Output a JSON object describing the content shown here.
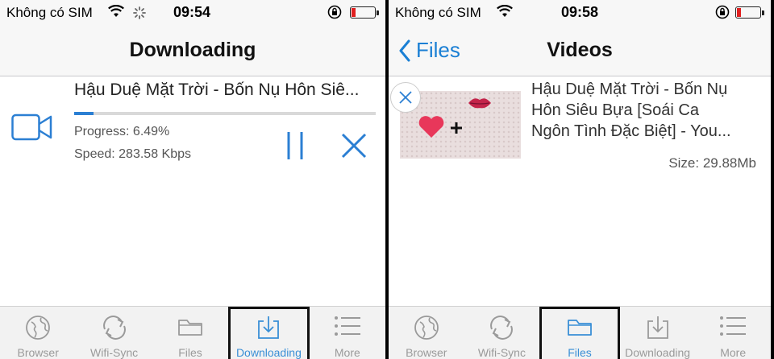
{
  "left": {
    "status": {
      "carrier": "Không có SIM",
      "time": "09:54"
    },
    "nav": {
      "title": "Downloading"
    },
    "download": {
      "title": "Hậu Duệ Mặt Trời - Bốn Nụ Hôn Siê...",
      "progress_text": "Progress: 6.49%",
      "speed_text": "Speed: 283.58 Kbps",
      "progress_value": 6.49
    },
    "tabs": [
      {
        "label": "Browser",
        "icon": "globe-icon"
      },
      {
        "label": "Wifi-Sync",
        "icon": "sync-icon"
      },
      {
        "label": "Files",
        "icon": "folder-icon"
      },
      {
        "label": "Downloading",
        "icon": "download-icon",
        "active": true
      },
      {
        "label": "More",
        "icon": "menu-icon"
      }
    ]
  },
  "right": {
    "status": {
      "carrier": "Không có SIM",
      "time": "09:58"
    },
    "nav": {
      "title": "Videos",
      "back": "Files"
    },
    "file": {
      "title_lines": [
        "Hậu Duệ Mặt Trời - Bốn Nụ",
        "Hôn Siêu Bựa [Soái Ca",
        "Ngôn Tình Đặc Biệt] - You..."
      ],
      "size": "Size: 29.88Mb"
    },
    "tabs": [
      {
        "label": "Browser",
        "icon": "globe-icon"
      },
      {
        "label": "Wifi-Sync",
        "icon": "sync-icon"
      },
      {
        "label": "Files",
        "icon": "folder-icon",
        "active": true
      },
      {
        "label": "Downloading",
        "icon": "download-icon"
      },
      {
        "label": "More",
        "icon": "menu-icon"
      }
    ]
  },
  "colors": {
    "accent": "#2b7fd3",
    "battery_low": "#e02020",
    "heart": "#e8375a"
  }
}
